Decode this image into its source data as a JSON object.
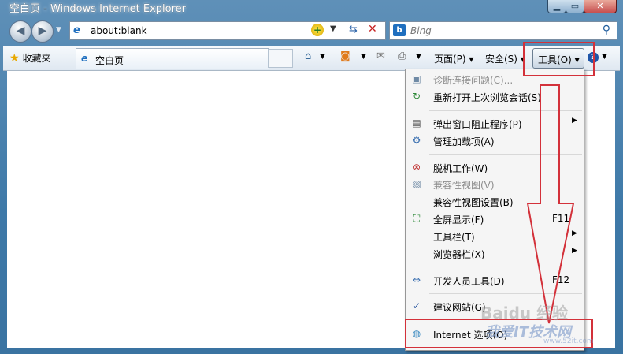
{
  "window": {
    "title": "空白页 - Windows Internet Explorer"
  },
  "nav": {
    "address": "about:blank",
    "search_placeholder": "Bing",
    "search_logo": "b"
  },
  "command_bar": {
    "favorites_label": "收藏夹",
    "tab_label": "空白页",
    "page_menu": "页面(P)",
    "safety_menu": "安全(S)",
    "tools_menu": "工具(O)"
  },
  "tools_menu": {
    "items": [
      {
        "label": "诊断连接问题(C)...",
        "icon": "diagnose-icon",
        "disabled": true
      },
      {
        "label": "重新打开上次浏览会话(S)",
        "icon": "reopen-session-icon"
      },
      {
        "label": "弹出窗口阻止程序(P)",
        "icon": "popup-blocker-icon",
        "submenu": true
      },
      {
        "label": "管理加载项(A)",
        "icon": "addons-icon"
      },
      {
        "label": "脱机工作(W)",
        "icon": "offline-icon"
      },
      {
        "label": "兼容性视图(V)",
        "icon": "compat-view-icon",
        "disabled": true
      },
      {
        "label": "兼容性视图设置(B)"
      },
      {
        "label": "全屏显示(F)",
        "shortcut": "F11",
        "icon": "fullscreen-icon"
      },
      {
        "label": "工具栏(T)",
        "submenu": true
      },
      {
        "label": "浏览器栏(X)",
        "submenu": true
      },
      {
        "label": "开发人员工具(D)",
        "shortcut": "F12",
        "icon": "dev-tools-icon"
      },
      {
        "label": "建议网站(G)",
        "icon": "check-icon",
        "checked": true
      },
      {
        "label": "Internet 选项(O)",
        "icon": "internet-options-icon"
      }
    ]
  },
  "watermark": {
    "line1": "Baidu 经验",
    "line2": "我爱IT技术网",
    "line3": "www.52it.com"
  },
  "colors": {
    "highlight_box": "#d3313a",
    "frame": "#3e79a8",
    "menu_bg": "#f5f5f5"
  }
}
